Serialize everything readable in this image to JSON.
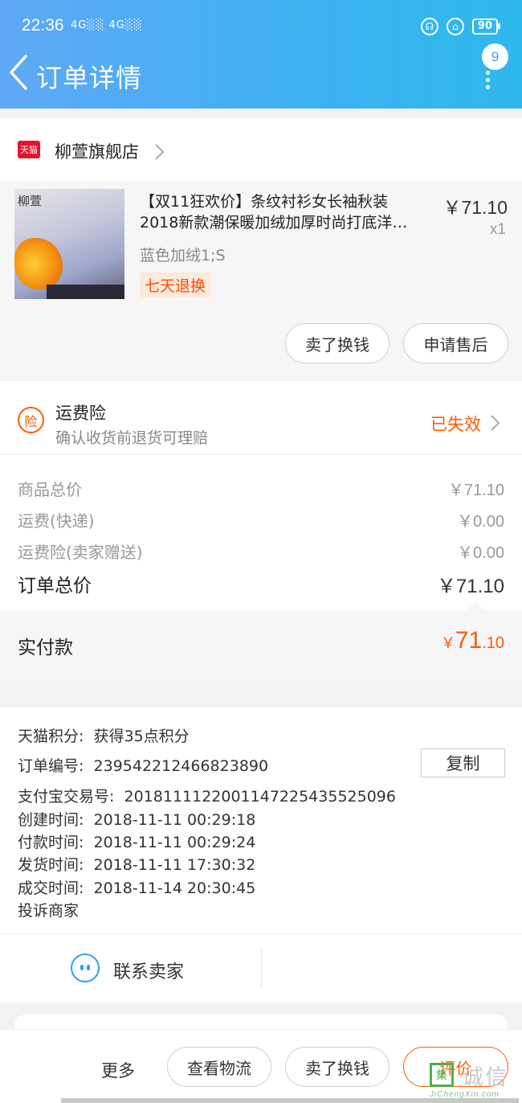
{
  "status_bar": {
    "time": "22:36",
    "signal": "4G░░ 4G░░",
    "battery": "90"
  },
  "header": {
    "title": "订单详情",
    "message_count": "9"
  },
  "store": {
    "badge": "天猫",
    "name": "柳萱旗舰店"
  },
  "product": {
    "brand_text": "柳萱",
    "title_line1": "【双11狂欢价】条纹衬衫女长袖秋装",
    "title_line2": "2018新款潮保暖加绒加厚时尚打底洋…",
    "price": "￥71.10",
    "quantity": "x1",
    "sku": "蓝色加绒1;S",
    "tag": "七天退换",
    "actions": {
      "sell": "卖了换钱",
      "after_sale": "申请售后"
    }
  },
  "insurance": {
    "icon_text": "险",
    "title": "运费险",
    "desc": "确认收货前退货可理赔",
    "status": "已失效"
  },
  "summary": {
    "rows": [
      {
        "label": "商品总价",
        "value": "￥71.10"
      },
      {
        "label": "运费(快递)",
        "value": "￥0.00"
      },
      {
        "label": "运费险(卖家赠送)",
        "value": "￥0.00"
      }
    ],
    "total_label": "订单总价",
    "total_value": "￥71.10",
    "paid_label": "实付款",
    "paid_currency": "￥",
    "paid_int": "71",
    "paid_dec": ".10"
  },
  "order_info": {
    "points": {
      "label": "天猫积分:",
      "value": "获得35点积分"
    },
    "order_no": {
      "label": "订单编号:",
      "value": "2395422124668238​90"
    },
    "copy_label": "复制",
    "alipay_no": {
      "label": "支付宝交易号:",
      "value": "2018111122001147225435525096"
    },
    "created": {
      "label": "创建时间:",
      "value": "2018-11-11 00:29:18"
    },
    "paid": {
      "label": "付款时间:",
      "value": "2018-11-11 00:29:24"
    },
    "shipped": {
      "label": "发货时间:",
      "value": "2018-11-11 17:30:32"
    },
    "completed": {
      "label": "成交时间:",
      "value": "2018-11-14 20:30:45"
    },
    "complaint": "投诉商家"
  },
  "contact": {
    "label": "联系卖家"
  },
  "bottom_bar": {
    "more": "更多",
    "logistics": "查看物流",
    "sell": "卖了换钱",
    "evaluate": "评价"
  },
  "watermark": {
    "box": "集",
    "main": "诚信",
    "sub": "JiChengXin.com"
  },
  "colors": {
    "accent": "#ff5a00",
    "header": "#3cb2f0",
    "tmall": "#e8132c",
    "contact": "#2aa3f2"
  }
}
